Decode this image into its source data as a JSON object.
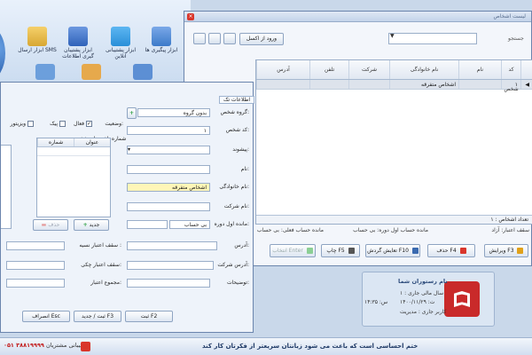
{
  "ribbon": {
    "items": [
      {
        "label": "ابزار ارسال SMS",
        "icon": "sms-envelope-icon",
        "color": "#d8a733"
      },
      {
        "label": "ابزار پشتیبان گیری اطلاعات",
        "icon": "backup-disk-icon",
        "color": "#2f62b9"
      },
      {
        "label": "ابزار پشتیبانی آنلاین",
        "icon": "teamviewer-icon",
        "color": "#2a8fd8"
      },
      {
        "label": "ابزار پیگیری ها",
        "icon": "followup-icon",
        "color": "#3c7ac9"
      }
    ]
  },
  "main": {
    "title": "لیست اشخاص",
    "search_button": "ورود از اکسل",
    "search_label": "جستجو",
    "columns": [
      "کد شخص",
      "نام",
      "نام خانوادگی",
      "شرکت",
      "تلفن",
      "آدرس"
    ],
    "rows": [
      {
        "code": "۱",
        "first_name": "",
        "last_name": "اشخاص متفرقه",
        "company": "",
        "phone": "",
        "address": ""
      }
    ],
    "grid_footer": "تعداد اشخاص : ۱",
    "status": {
      "ceiling": "سقف اعتبار: آزاد",
      "balance_start": "مانده حساب اول دوره: بی حساب",
      "balance_now": "مانده حساب فعلی: بی حساب"
    },
    "actions": [
      {
        "label": "ویرایش F3",
        "disabled": false,
        "icon": "edit-icon",
        "color": "#e0a11a"
      },
      {
        "label": "حذف F4",
        "disabled": false,
        "icon": "delete-icon",
        "color": "#d9362b"
      },
      {
        "label": "تعایش گردش F10",
        "disabled": false,
        "icon": "view-icon",
        "color": "#3a6ab0"
      },
      {
        "label": "چاپ F5",
        "disabled": false,
        "icon": "print-icon",
        "color": "#555555"
      },
      {
        "label": "انتخاب Enter",
        "disabled": true,
        "icon": "select-icon",
        "color": "#2fa043"
      }
    ]
  },
  "form": {
    "tab_label": "اطلاعات تک",
    "group_label": "گروه شخص:",
    "group_value": "بدون گروه",
    "status_label": "وضعیت:",
    "status_options": [
      {
        "label": "فعال",
        "checked": true
      },
      {
        "label": "پیک",
        "checked": false
      },
      {
        "label": "ویزیتور",
        "checked": false
      }
    ],
    "code_label": "کد شخص:",
    "code_value": "۱",
    "prefix_label": "پیشوند:",
    "name_label": "نام:",
    "lastname_label": "نام خانوادگی:",
    "lastname_value": "اشخاص متفرقه",
    "company_label": "نام شرکت:",
    "opening_label": "مانده اول دوره:",
    "opening_value": "بی حساب",
    "phones_caption": "شماره تلفن های شخص",
    "phones_columns": [
      "عنوان",
      "شماره"
    ],
    "new_button": "جدید",
    "delete_button": "حذف",
    "address_label": "آدرس:",
    "credit_label": "سقف اعتبار نسیه :",
    "company_address_label": "آدرس شرکت:",
    "check_credit_label": "سقف اعتبار چکی:",
    "notes_label": "توضیحات:",
    "credit_total_label": "مجموع اعتبار:",
    "buttons": [
      {
        "label": "ثبت F2"
      },
      {
        "label": "ثبت / جدید F3"
      },
      {
        "label": "انصراف Esc"
      }
    ]
  },
  "card": {
    "title": "نام رستوران شما",
    "year": "سال مالی جاری : ۱",
    "date": "ت: ۱۴۰۰/۱۱/۲۹",
    "time": "س: ۱۴:۳۵",
    "user": "کاربر جاری : مدیریت"
  },
  "footer": {
    "message": "ختم احساسی است که باعث می شود زبانتان سریعتر از فکرتان کار کند",
    "support_label": "پشتیبانی مشتریان",
    "support_number": "۰۵۱ ۳۸۸۱۹۹۹۹"
  },
  "colors": {
    "accent": "#2b4a7a",
    "highlight": "#fff6b8",
    "danger": "#d9362b"
  }
}
